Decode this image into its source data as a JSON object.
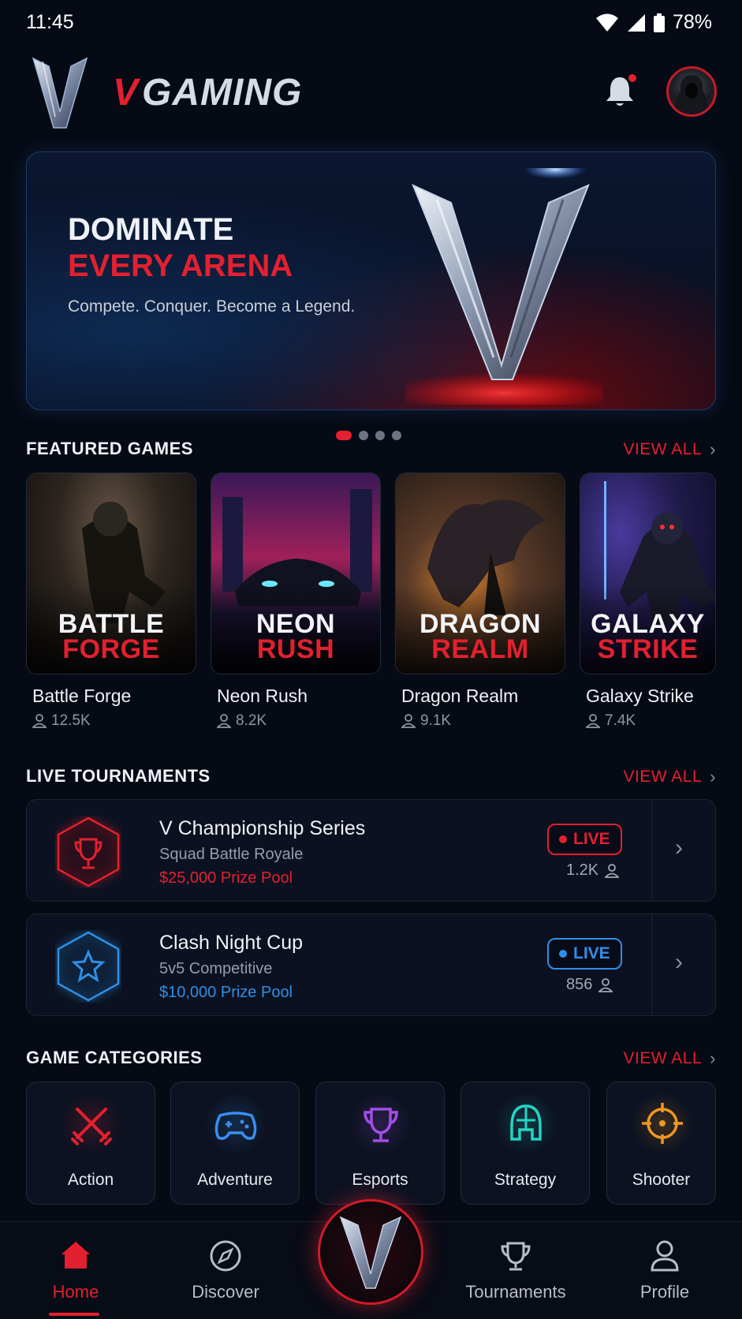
{
  "status_bar": {
    "time": "11:45",
    "battery": "78%"
  },
  "header": {
    "brand_v": "V",
    "brand_word": "GAMING",
    "notification_badge": true
  },
  "hero": {
    "line1": "DOMINATE",
    "line2": "EVERY ARENA",
    "subtitle": "Compete. Conquer. Become a Legend.",
    "carousel_count": 4,
    "carousel_active": 1
  },
  "featured": {
    "title": "FEATURED GAMES",
    "view_all": "VIEW ALL",
    "games": [
      {
        "art_line1": "BATTLE",
        "art_line2": "FORGE",
        "name": "Battle Forge",
        "players": "12.5K",
        "theme": "war"
      },
      {
        "art_line1": "NEON",
        "art_line2": "RUSH",
        "name": "Neon Rush",
        "players": "8.2K",
        "theme": "neon"
      },
      {
        "art_line1": "DRAGON",
        "art_line2": "REALM",
        "name": "Dragon Realm",
        "players": "9.1K",
        "theme": "dragon"
      },
      {
        "art_line1": "GALAXY",
        "art_line2": "STRIKE",
        "name": "Galaxy Strike",
        "players": "7.4K",
        "theme": "space"
      }
    ]
  },
  "tournaments": {
    "title": "LIVE TOURNAMENTS",
    "view_all": "VIEW ALL",
    "items": [
      {
        "name": "V Championship Series",
        "mode": "Squad Battle Royale",
        "prize": "$25,000 Prize Pool",
        "status": "LIVE",
        "count": "1.2K",
        "accent": "#e3202f",
        "icon": "trophy-icon"
      },
      {
        "name": "Clash Night Cup",
        "mode": "5v5 Competitive",
        "prize": "$10,000 Prize Pool",
        "status": "LIVE",
        "count": "856",
        "accent": "#2f8fe6",
        "icon": "star-icon"
      }
    ]
  },
  "categories": {
    "title": "GAME CATEGORIES",
    "view_all": "VIEW ALL",
    "items": [
      {
        "label": "Action",
        "icon": "swords-icon",
        "color": "#e3202f"
      },
      {
        "label": "Adventure",
        "icon": "gamepad-icon",
        "color": "#3a8ff0"
      },
      {
        "label": "Esports",
        "icon": "trophy-icon",
        "color": "#a24ee6"
      },
      {
        "label": "Strategy",
        "icon": "helmet-icon",
        "color": "#26d3c4"
      },
      {
        "label": "Shooter",
        "icon": "crosshair-icon",
        "color": "#f0971f"
      }
    ]
  },
  "bottom_nav": {
    "items": [
      {
        "label": "Home",
        "icon": "home-icon",
        "active": true
      },
      {
        "label": "Discover",
        "icon": "compass-icon",
        "active": false
      },
      {
        "label": "Tournaments",
        "icon": "trophy-icon",
        "active": false
      },
      {
        "label": "Profile",
        "icon": "user-icon",
        "active": false
      }
    ]
  },
  "colors": {
    "accent": "#e3202f",
    "background": "#060a14",
    "blue_accent": "#2f8fe6"
  }
}
